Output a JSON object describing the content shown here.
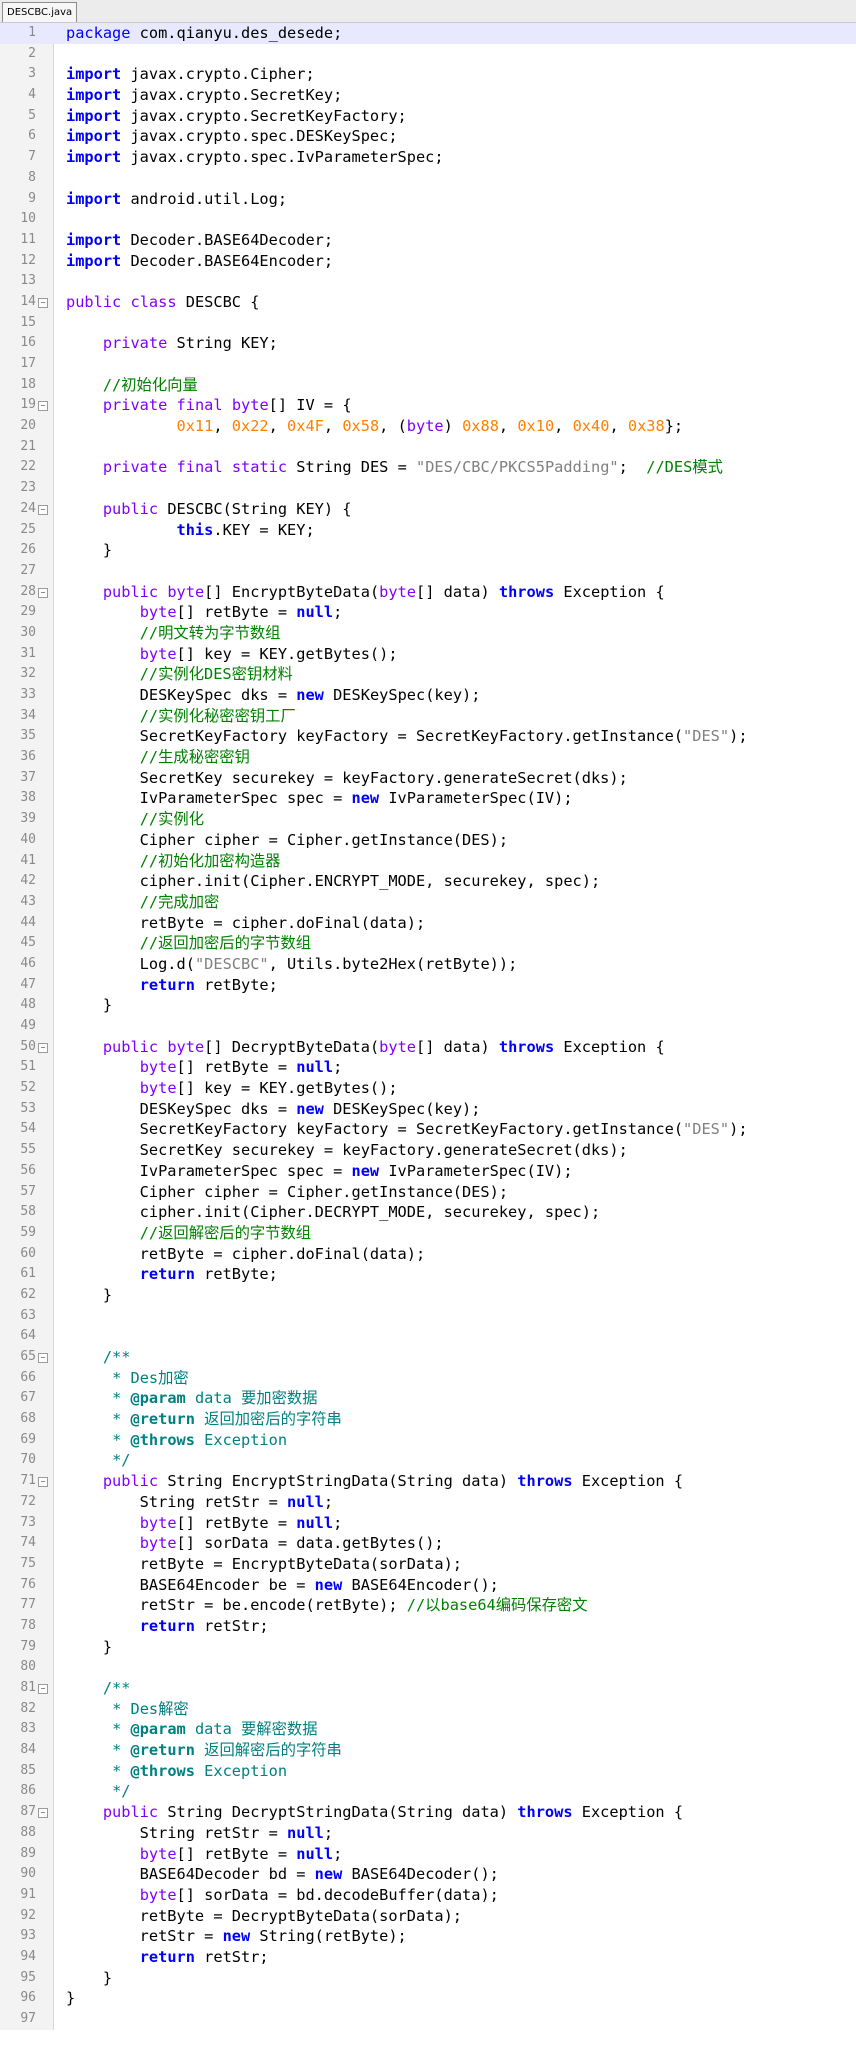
{
  "tab": {
    "label": "DESCBC.java"
  },
  "lines": [
    {
      "n": "1",
      "html": "<span class=\"kw2\">package</span> com.qianyu.des_desede;",
      "hl": true
    },
    {
      "n": "2",
      "html": ""
    },
    {
      "n": "3",
      "html": "<span class=\"kw\">import</span> javax.crypto.Cipher;"
    },
    {
      "n": "4",
      "html": "<span class=\"kw\">import</span> javax.crypto.SecretKey;"
    },
    {
      "n": "5",
      "html": "<span class=\"kw\">import</span> javax.crypto.SecretKeyFactory;"
    },
    {
      "n": "6",
      "html": "<span class=\"kw\">import</span> javax.crypto.spec.DESKeySpec;"
    },
    {
      "n": "7",
      "html": "<span class=\"kw\">import</span> javax.crypto.spec.IvParameterSpec;"
    },
    {
      "n": "8",
      "html": ""
    },
    {
      "n": "9",
      "html": "<span class=\"kw\">import</span> android.util.Log;"
    },
    {
      "n": "10",
      "html": ""
    },
    {
      "n": "11",
      "html": "<span class=\"kw\">import</span> Decoder.BASE64Decoder;"
    },
    {
      "n": "12",
      "html": "<span class=\"kw\">import</span> Decoder.BASE64Encoder;"
    },
    {
      "n": "13",
      "html": ""
    },
    {
      "n": "14",
      "html": "<span class=\"type\">public</span> <span class=\"type\">class</span> DESCBC {",
      "fold": true
    },
    {
      "n": "15",
      "html": ""
    },
    {
      "n": "16",
      "html": "    <span class=\"type\">private</span> String KEY;"
    },
    {
      "n": "17",
      "html": ""
    },
    {
      "n": "18",
      "html": "    <span class=\"com\">//初始化向量</span>"
    },
    {
      "n": "19",
      "html": "    <span class=\"type\">private</span> <span class=\"type\">final</span> <span class=\"type\">byte</span>[] IV = {",
      "fold": true
    },
    {
      "n": "20",
      "html": "            <span class=\"num\">0x11</span>, <span class=\"num\">0x22</span>, <span class=\"num\">0x4F</span>, <span class=\"num\">0x58</span>, (<span class=\"type\">byte</span>) <span class=\"num\">0x88</span>, <span class=\"num\">0x10</span>, <span class=\"num\">0x40</span>, <span class=\"num\">0x38</span>};"
    },
    {
      "n": "21",
      "html": ""
    },
    {
      "n": "22",
      "html": "    <span class=\"type\">private</span> <span class=\"type\">final</span> <span class=\"type\">static</span> String DES = <span class=\"str\">\"DES/CBC/PKCS5Padding\"</span>;  <span class=\"com\">//DES模式</span>"
    },
    {
      "n": "23",
      "html": ""
    },
    {
      "n": "24",
      "html": "    <span class=\"type\">public</span> DESCBC(String KEY) {",
      "fold": true
    },
    {
      "n": "25",
      "html": "            <span class=\"kw\">this</span>.KEY = KEY;"
    },
    {
      "n": "26",
      "html": "    }"
    },
    {
      "n": "27",
      "html": ""
    },
    {
      "n": "28",
      "html": "    <span class=\"type\">public</span> <span class=\"type\">byte</span>[] EncryptByteData(<span class=\"type\">byte</span>[] data) <span class=\"kw\">throws</span> Exception {",
      "fold": true
    },
    {
      "n": "29",
      "html": "        <span class=\"type\">byte</span>[] retByte = <span class=\"kw\">null</span>;"
    },
    {
      "n": "30",
      "html": "        <span class=\"com\">//明文转为字节数组</span>"
    },
    {
      "n": "31",
      "html": "        <span class=\"type\">byte</span>[] key = KEY.getBytes();"
    },
    {
      "n": "32",
      "html": "        <span class=\"com\">//实例化DES密钥材料</span>"
    },
    {
      "n": "33",
      "html": "        DESKeySpec dks = <span class=\"kw\">new</span> DESKeySpec(key);"
    },
    {
      "n": "34",
      "html": "        <span class=\"com\">//实例化秘密密钥工厂</span>"
    },
    {
      "n": "35",
      "html": "        SecretKeyFactory keyFactory = SecretKeyFactory.getInstance(<span class=\"str\">\"DES\"</span>);"
    },
    {
      "n": "36",
      "html": "        <span class=\"com\">//生成秘密密钥</span>"
    },
    {
      "n": "37",
      "html": "        SecretKey securekey = keyFactory.generateSecret(dks);"
    },
    {
      "n": "38",
      "html": "        IvParameterSpec spec = <span class=\"kw\">new</span> IvParameterSpec(IV);"
    },
    {
      "n": "39",
      "html": "        <span class=\"com\">//实例化</span>"
    },
    {
      "n": "40",
      "html": "        Cipher cipher = Cipher.getInstance(DES);"
    },
    {
      "n": "41",
      "html": "        <span class=\"com\">//初始化加密构造器</span>"
    },
    {
      "n": "42",
      "html": "        cipher.init(Cipher.ENCRYPT_MODE, securekey, spec);"
    },
    {
      "n": "43",
      "html": "        <span class=\"com\">//完成加密</span>"
    },
    {
      "n": "44",
      "html": "        retByte = cipher.doFinal(data);"
    },
    {
      "n": "45",
      "html": "        <span class=\"com\">//返回加密后的字节数组</span>"
    },
    {
      "n": "46",
      "html": "        Log.d(<span class=\"str\">\"DESCBC\"</span>, Utils.byte2Hex(retByte));"
    },
    {
      "n": "47",
      "html": "        <span class=\"kw\">return</span> retByte;"
    },
    {
      "n": "48",
      "html": "    }"
    },
    {
      "n": "49",
      "html": ""
    },
    {
      "n": "50",
      "html": "    <span class=\"type\">public</span> <span class=\"type\">byte</span>[] DecryptByteData(<span class=\"type\">byte</span>[] data) <span class=\"kw\">throws</span> Exception {",
      "fold": true
    },
    {
      "n": "51",
      "html": "        <span class=\"type\">byte</span>[] retByte = <span class=\"kw\">null</span>;"
    },
    {
      "n": "52",
      "html": "        <span class=\"type\">byte</span>[] key = KEY.getBytes();"
    },
    {
      "n": "53",
      "html": "        DESKeySpec dks = <span class=\"kw\">new</span> DESKeySpec(key);"
    },
    {
      "n": "54",
      "html": "        SecretKeyFactory keyFactory = SecretKeyFactory.getInstance(<span class=\"str\">\"DES\"</span>);"
    },
    {
      "n": "55",
      "html": "        SecretKey securekey = keyFactory.generateSecret(dks);"
    },
    {
      "n": "56",
      "html": "        IvParameterSpec spec = <span class=\"kw\">new</span> IvParameterSpec(IV);"
    },
    {
      "n": "57",
      "html": "        Cipher cipher = Cipher.getInstance(DES);"
    },
    {
      "n": "58",
      "html": "        cipher.init(Cipher.DECRYPT_MODE, securekey, spec);"
    },
    {
      "n": "59",
      "html": "        <span class=\"com\">//返回解密后的字节数组</span>"
    },
    {
      "n": "60",
      "html": "        retByte = cipher.doFinal(data);"
    },
    {
      "n": "61",
      "html": "        <span class=\"kw\">return</span> retByte;"
    },
    {
      "n": "62",
      "html": "    }"
    },
    {
      "n": "63",
      "html": ""
    },
    {
      "n": "64",
      "html": ""
    },
    {
      "n": "65",
      "html": "    <span class=\"doc\">/**</span>",
      "fold": true
    },
    {
      "n": "66",
      "html": "     <span class=\"doc\">* Des加密</span>"
    },
    {
      "n": "67",
      "html": "     <span class=\"doc\">* </span><span class=\"doctag\">@param</span><span class=\"doc\"> data 要加密数据</span>"
    },
    {
      "n": "68",
      "html": "     <span class=\"doc\">* </span><span class=\"doctag\">@return</span><span class=\"doc\"> 返回加密后的字符串</span>"
    },
    {
      "n": "69",
      "html": "     <span class=\"doc\">* </span><span class=\"doctag\">@throws</span><span class=\"doc\"> Exception</span>"
    },
    {
      "n": "70",
      "html": "     <span class=\"doc\">*/</span>"
    },
    {
      "n": "71",
      "html": "    <span class=\"type\">public</span> String EncryptStringData(String data) <span class=\"kw\">throws</span> Exception {",
      "fold": true
    },
    {
      "n": "72",
      "html": "        String retStr = <span class=\"kw\">null</span>;"
    },
    {
      "n": "73",
      "html": "        <span class=\"type\">byte</span>[] retByte = <span class=\"kw\">null</span>;"
    },
    {
      "n": "74",
      "html": "        <span class=\"type\">byte</span>[] sorData = data.getBytes();"
    },
    {
      "n": "75",
      "html": "        retByte = EncryptByteData(sorData);"
    },
    {
      "n": "76",
      "html": "        BASE64Encoder be = <span class=\"kw\">new</span> BASE64Encoder();"
    },
    {
      "n": "77",
      "html": "        retStr = be.encode(retByte); <span class=\"com\">//以base64编码保存密文</span>"
    },
    {
      "n": "78",
      "html": "        <span class=\"kw\">return</span> retStr;"
    },
    {
      "n": "79",
      "html": "    }"
    },
    {
      "n": "80",
      "html": ""
    },
    {
      "n": "81",
      "html": "    <span class=\"doc\">/**</span>",
      "fold": true
    },
    {
      "n": "82",
      "html": "     <span class=\"doc\">* Des解密</span>"
    },
    {
      "n": "83",
      "html": "     <span class=\"doc\">* </span><span class=\"doctag\">@param</span><span class=\"doc\"> data 要解密数据</span>"
    },
    {
      "n": "84",
      "html": "     <span class=\"doc\">* </span><span class=\"doctag\">@return</span><span class=\"doc\"> 返回解密后的字符串</span>"
    },
    {
      "n": "85",
      "html": "     <span class=\"doc\">* </span><span class=\"doctag\">@throws</span><span class=\"doc\"> Exception</span>"
    },
    {
      "n": "86",
      "html": "     <span class=\"doc\">*/</span>"
    },
    {
      "n": "87",
      "html": "    <span class=\"type\">public</span> String DecryptStringData(String data) <span class=\"kw\">throws</span> Exception {",
      "fold": true
    },
    {
      "n": "88",
      "html": "        String retStr = <span class=\"kw\">null</span>;"
    },
    {
      "n": "89",
      "html": "        <span class=\"type\">byte</span>[] retByte = <span class=\"kw\">null</span>;"
    },
    {
      "n": "90",
      "html": "        BASE64Decoder bd = <span class=\"kw\">new</span> BASE64Decoder();"
    },
    {
      "n": "91",
      "html": "        <span class=\"type\">byte</span>[] sorData = bd.decodeBuffer(data);"
    },
    {
      "n": "92",
      "html": "        retByte = DecryptByteData(sorData);"
    },
    {
      "n": "93",
      "html": "        retStr = <span class=\"kw\">new</span> String(retByte);"
    },
    {
      "n": "94",
      "html": "        <span class=\"kw\">return</span> retStr;"
    },
    {
      "n": "95",
      "html": "    }"
    },
    {
      "n": "96",
      "html": "}"
    },
    {
      "n": "97",
      "html": ""
    }
  ]
}
